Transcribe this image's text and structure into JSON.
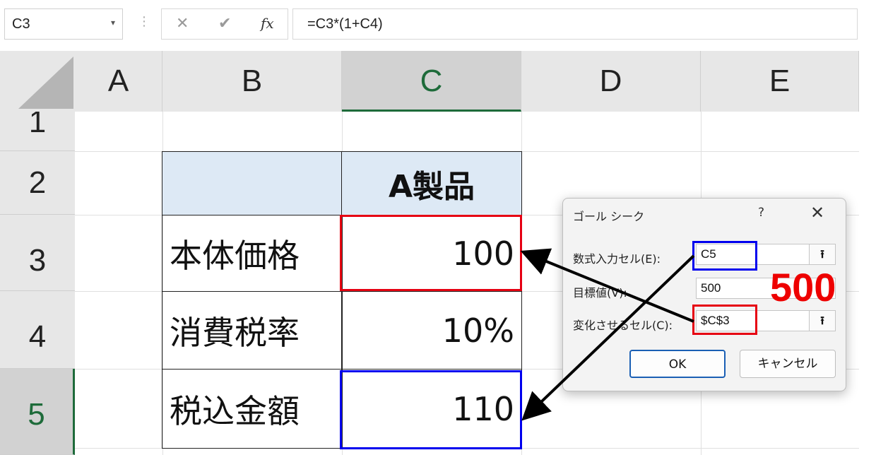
{
  "formula_bar": {
    "name_box": "C3",
    "name_box_arrow": "▾",
    "separator": "⋮",
    "cancel_icon": "✕",
    "enter_icon": "✔",
    "fx_icon": "fx",
    "formula": "=C3*(1+C4)"
  },
  "columns": [
    "A",
    "B",
    "C",
    "D",
    "E"
  ],
  "rows": [
    "1",
    "2",
    "3",
    "4",
    "5"
  ],
  "table": {
    "product_header": "A製品",
    "labels": [
      "本体価格",
      "消費税率",
      "税込金額"
    ],
    "values": [
      "100",
      "10%",
      "110"
    ]
  },
  "dialog": {
    "title": "ゴール シーク",
    "help": "?",
    "close": "✕",
    "set_cell_label": "数式入力セル(E):",
    "set_cell_value": "C5",
    "to_value_label": "目標値(V):",
    "to_value_value": "500",
    "changing_cell_label": "変化させるセル(C):",
    "changing_cell_value": "$C$3",
    "ref_icon": "⭱",
    "ok_label": "OK",
    "cancel_label": "キャンセル"
  },
  "annotation": {
    "target_value": "500"
  },
  "colors": {
    "accent_green": "#1e6b3a",
    "highlight_red": "#e60012",
    "highlight_blue": "#0000ee",
    "header_fill": "#dde9f5"
  }
}
